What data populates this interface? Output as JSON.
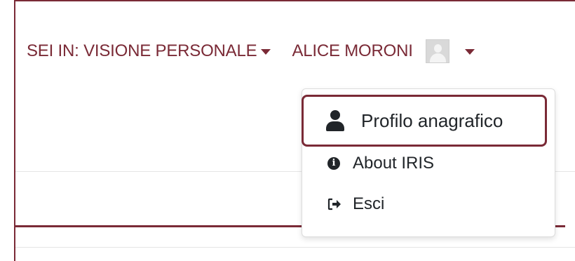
{
  "header": {
    "context_label": "SEI IN: VISIONE PERSONALE",
    "user_name": "ALICE MORONI"
  },
  "user_menu": {
    "items": [
      {
        "label": "Profilo anagrafico",
        "icon": "user-icon"
      },
      {
        "label": "About IRIS",
        "icon": "info-circle-icon"
      },
      {
        "label": "Esci",
        "icon": "sign-out-icon"
      }
    ]
  },
  "colors": {
    "accent": "#7a2a36",
    "text": "#212529",
    "avatar_bg": "#d9d9d9"
  }
}
